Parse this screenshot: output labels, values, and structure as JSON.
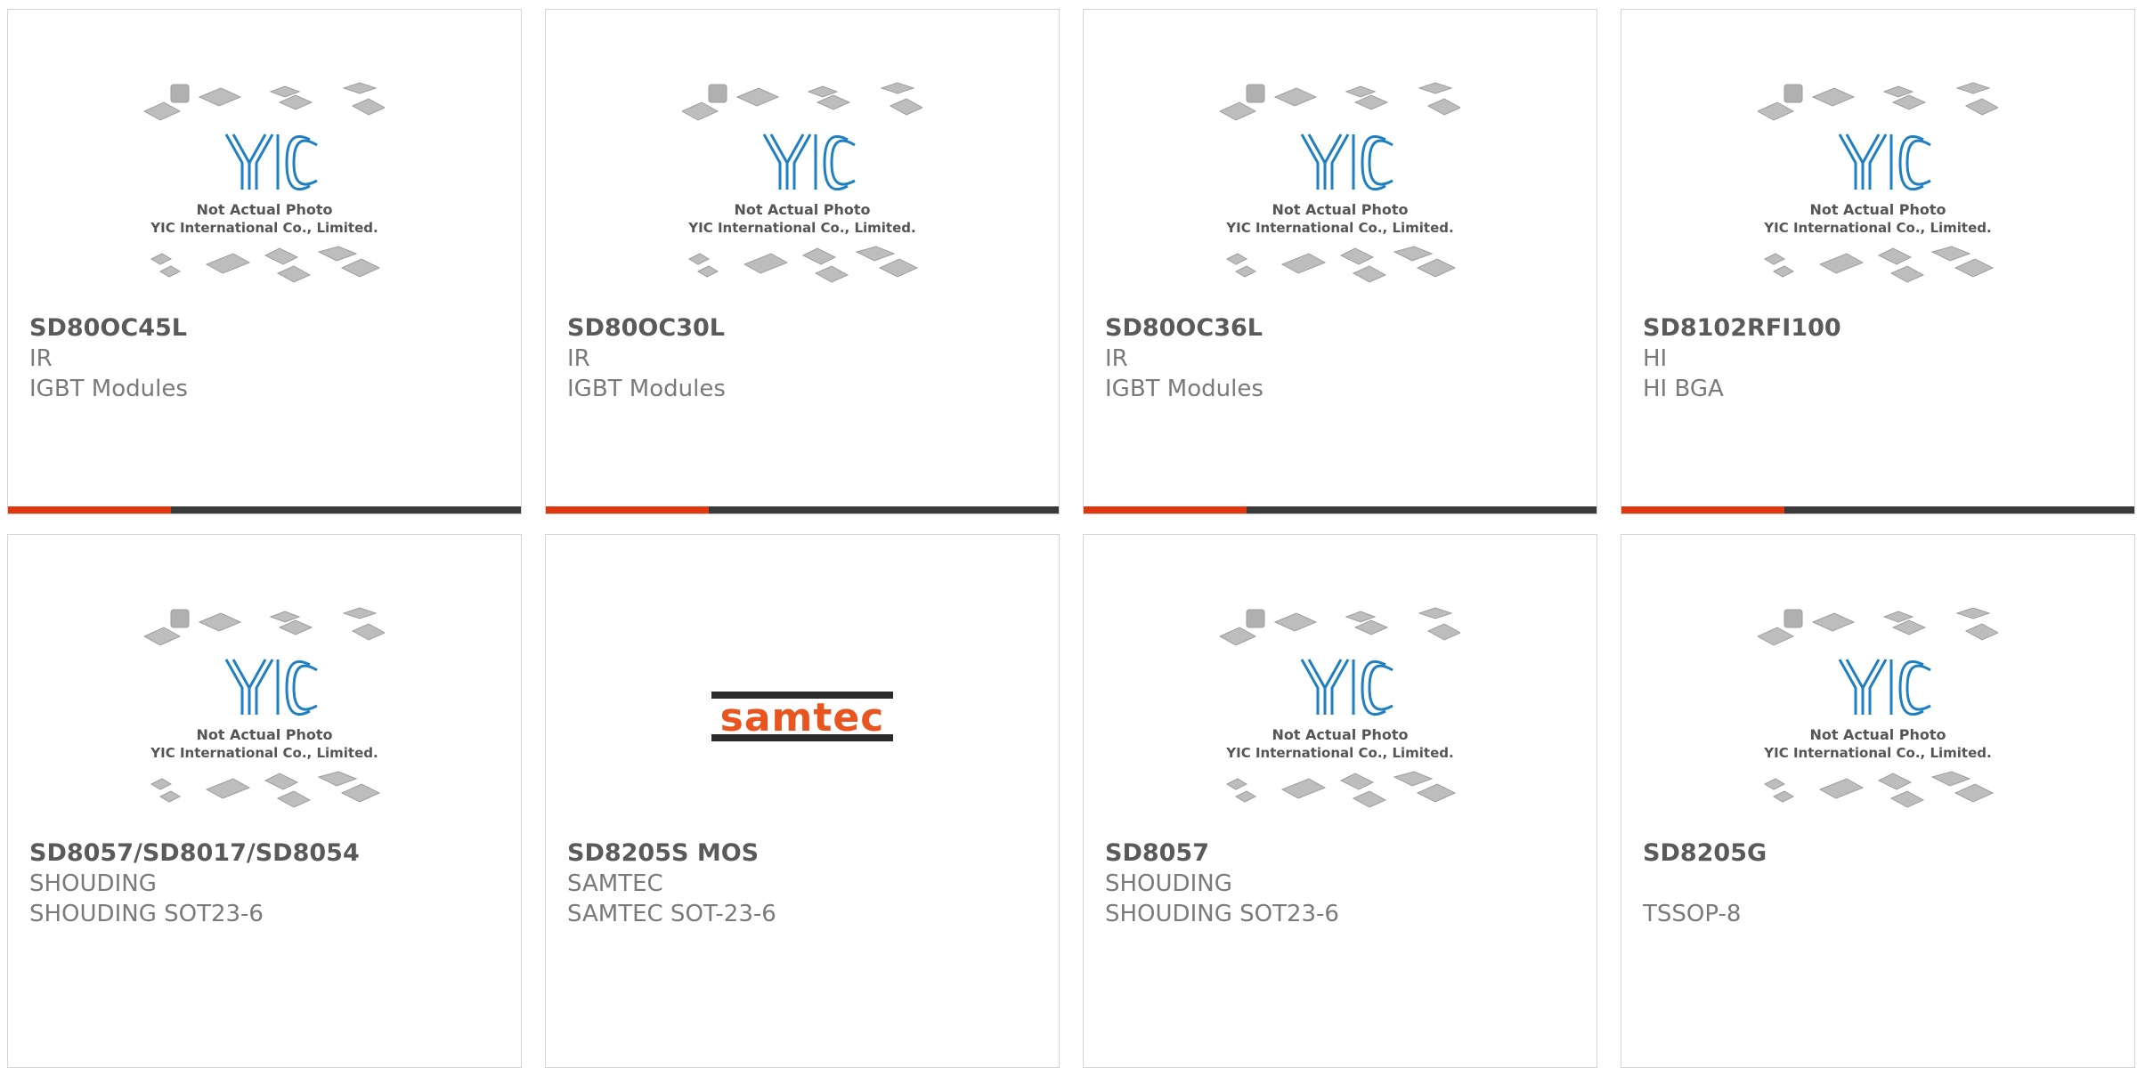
{
  "products": [
    {
      "part_number": "SD80OC45L",
      "manufacturer": "IR",
      "category": "IGBT Modules",
      "image": "yic-placeholder-icon",
      "image_caption_line1": "Not Actual Photo",
      "image_caption_line2": "YIC International Co., Limited.",
      "logo_text": "YIC"
    },
    {
      "part_number": "SD80OC30L",
      "manufacturer": "IR",
      "category": "IGBT Modules",
      "image": "yic-placeholder-icon",
      "image_caption_line1": "Not Actual Photo",
      "image_caption_line2": "YIC International Co., Limited.",
      "logo_text": "YIC"
    },
    {
      "part_number": "SD80OC36L",
      "manufacturer": "IR",
      "category": "IGBT Modules",
      "image": "yic-placeholder-icon",
      "image_caption_line1": "Not Actual Photo",
      "image_caption_line2": "YIC International Co., Limited.",
      "logo_text": "YIC"
    },
    {
      "part_number": "SD8102RFI100",
      "manufacturer": "HI",
      "category": "HI BGA",
      "image": "yic-placeholder-icon",
      "image_caption_line1": "Not Actual Photo",
      "image_caption_line2": "YIC International Co., Limited.",
      "logo_text": "YIC"
    },
    {
      "part_number": "SD8057/SD8017/SD8054",
      "manufacturer": "SHOUDING",
      "category": "SHOUDING SOT23-6",
      "image": "yic-placeholder-icon",
      "image_caption_line1": "Not Actual Photo",
      "image_caption_line2": "YIC International Co., Limited.",
      "logo_text": "YIC"
    },
    {
      "part_number": "SD8205S MOS",
      "manufacturer": "SAMTEC",
      "category": "SAMTEC SOT-23-6",
      "image": "samtec-logo",
      "logo_text": "samtec"
    },
    {
      "part_number": "SD8057",
      "manufacturer": "SHOUDING",
      "category": "SHOUDING SOT23-6",
      "image": "yic-placeholder-icon",
      "image_caption_line1": "Not Actual Photo",
      "image_caption_line2": "YIC International Co., Limited.",
      "logo_text": "YIC"
    },
    {
      "part_number": "SD8205G",
      "manufacturer": "",
      "category": "TSSOP-8",
      "image": "yic-placeholder-icon",
      "image_caption_line1": "Not Actual Photo",
      "image_caption_line2": "YIC International Co., Limited.",
      "logo_text": "YIC"
    }
  ],
  "colors": {
    "accent": "#e0370e",
    "bar": "#3a3a3a",
    "border": "#d4d4d4",
    "title": "#5a5a5a",
    "text": "#7a7a7a",
    "yic_blue": "#1f7fc1",
    "samtec_orange": "#e8551e"
  }
}
